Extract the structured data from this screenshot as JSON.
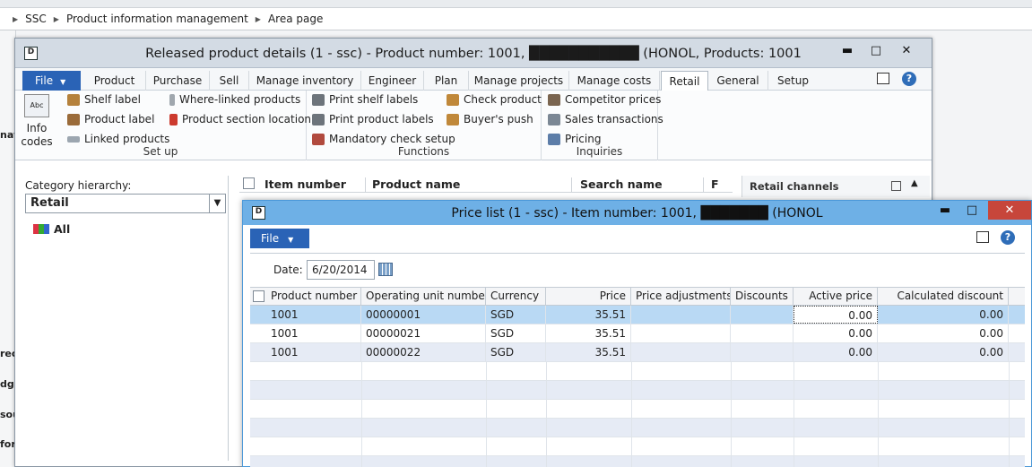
{
  "breadcrumb": {
    "items": [
      "SSC",
      "Product information management",
      "Area page"
    ]
  },
  "left_cut": {
    "labels": [
      "nat",
      "rec",
      "dge",
      "sou",
      "for"
    ]
  },
  "main_window": {
    "title": "Released product details (1 - ssc) - Product number: 1001, ███████████ (HONOL, Products: 1001",
    "controls": {
      "minimize": "▬",
      "maximize": "□",
      "close": "✕"
    },
    "file_tab": "File",
    "tabs": [
      "Product",
      "Purchase",
      "Sell",
      "Manage inventory",
      "Engineer",
      "Plan",
      "Manage projects",
      "Manage costs",
      "Retail",
      "General",
      "Setup"
    ],
    "active_tab": "Retail",
    "ribbon": {
      "setup": {
        "label": "Set up",
        "info_codes_line1": "Info",
        "info_codes_line2": "codes",
        "shelf_label": "Shelf label",
        "product_label": "Product label",
        "linked_products": "Linked products",
        "where_linked_products": "Where-linked products",
        "product_section_location": "Product section location"
      },
      "functions": {
        "label": "Functions",
        "print_shelf_labels": "Print shelf labels",
        "print_product_labels": "Print product labels",
        "mandatory_check_setup": "Mandatory check setup",
        "check_product": "Check product",
        "buyers_push": "Buyer's push"
      },
      "inquiries": {
        "label": "Inquiries",
        "competitor_prices": "Competitor prices",
        "sales_transactions": "Sales transactions",
        "pricing": "Pricing"
      }
    },
    "category": {
      "label": "Category hierarchy:",
      "selected": "Retail",
      "tree_root": "All"
    },
    "grid_headers": [
      "Item number",
      "Product name",
      "Search name",
      "F"
    ],
    "right_panel_title": "Retail channels"
  },
  "price_window": {
    "title": "Price list (1 - ssc) - Item number: 1001, ███████ (HONOL",
    "file_tab": "File",
    "date_label": "Date:",
    "date_value": "6/20/2014",
    "columns": [
      "Product number",
      "Operating unit number",
      "Currency",
      "Price",
      "Price adjustments",
      "Discounts",
      "Active price",
      "Calculated discount"
    ],
    "rows": [
      {
        "product": "1001",
        "unit": "00000001",
        "currency": "SGD",
        "price": "35.51",
        "adj": "",
        "disc": "",
        "active": "0.00",
        "calc": "0.00"
      },
      {
        "product": "1001",
        "unit": "00000021",
        "currency": "SGD",
        "price": "35.51",
        "adj": "",
        "disc": "",
        "active": "0.00",
        "calc": "0.00"
      },
      {
        "product": "1001",
        "unit": "00000022",
        "currency": "SGD",
        "price": "35.51",
        "adj": "",
        "disc": "",
        "active": "0.00",
        "calc": "0.00"
      }
    ]
  },
  "colors": {
    "file_tab": "#2a63b6",
    "price_titlebar": "#6eb0e6",
    "selected_row": "#b9d9f4",
    "close_button": "#c7463b"
  }
}
